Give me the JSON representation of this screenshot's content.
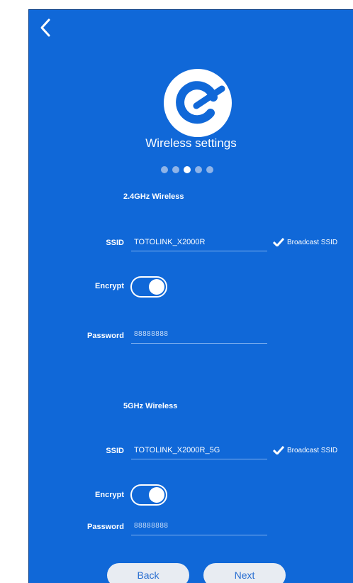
{
  "header": {
    "back_icon": "chevron-left-icon",
    "logo_icon": "brand-e-logo-icon"
  },
  "wizard": {
    "title": "Wireless settings",
    "steps_total": 5,
    "current_step": 3
  },
  "band_24": {
    "section_title": "2.4GHz Wireless",
    "ssid_label": "SSID",
    "ssid_value": "TOTOLINK_X2000R",
    "broadcast_label": "Broadcast SSID",
    "broadcast_checked": true,
    "encrypt_label": "Encrypt",
    "encrypt_on": true,
    "password_label": "Password",
    "password_value": "88888888"
  },
  "band_5": {
    "section_title": "5GHz Wireless",
    "ssid_label": "SSID",
    "ssid_value": "TOTOLINK_X2000R_5G",
    "broadcast_label": "Broadcast SSID",
    "broadcast_checked": true,
    "encrypt_label": "Encrypt",
    "encrypt_on": true,
    "password_label": "Password",
    "password_value": "88888888"
  },
  "footer": {
    "back_label": "Back",
    "next_label": "Next"
  },
  "colors": {
    "background": "#1068d8",
    "text": "#ffffff",
    "button_bg": "#e8ecf2",
    "button_text": "#2a6fd1"
  }
}
